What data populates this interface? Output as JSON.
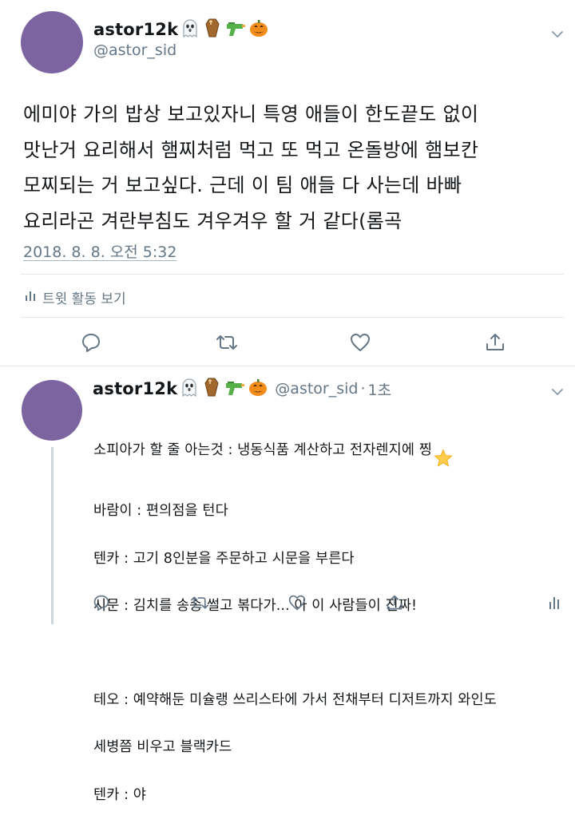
{
  "main_tweet": {
    "display_name": "astor12k",
    "handle": "@astor_sid",
    "name_emoji": [
      "ghost-icon",
      "coffin-icon",
      "water-pistol-icon",
      "jack-o-lantern-icon"
    ],
    "text_lines": [
      "에미야 가의 밥상 보고있자니 특영 애들이 한도끝도 없이",
      "맛난거 요리해서 햄찌처럼 먹고 또 먹고 온돌방에 햄보칸",
      "모찌되는 거 보고싶다. 근데 이 팀 애들 다 사는데 바빠",
      "요리라곤 겨란부침도 겨우겨우 할 거 같다(롬곡"
    ],
    "timestamp": "2018. 8. 8. 오전 5:32",
    "activity_label": "트윗 활동 보기"
  },
  "actions": [
    "reply-icon",
    "retweet-icon",
    "like-icon",
    "share-icon"
  ],
  "reply": {
    "display_name": "astor12k",
    "handle": "@astor_sid",
    "separator": "·",
    "time": "1초",
    "lines": [
      "소피아가 할 줄 아는것 : 냉동식품 계산하고 전자렌지에 찡",
      "바람이 : 편의점을 턴다",
      "텐카 : 고기 8인분을 주문하고 시문을 부른다",
      "시문 : 김치를 송송 썰고 볶다가... 아 이 사람들이 진짜!",
      "",
      "테오 : 예약해둔 미슐랭 쓰리스타에 가서 전채부터 디저트까지 와인도",
      "세병쯤 비우고 블랙카드",
      "텐카 : 야"
    ],
    "star_icon": "star-icon"
  },
  "colors": {
    "avatar": "#7b64a0",
    "secondary": "#657786",
    "divider": "#e1e8ed",
    "thread": "#ccd6dd"
  }
}
